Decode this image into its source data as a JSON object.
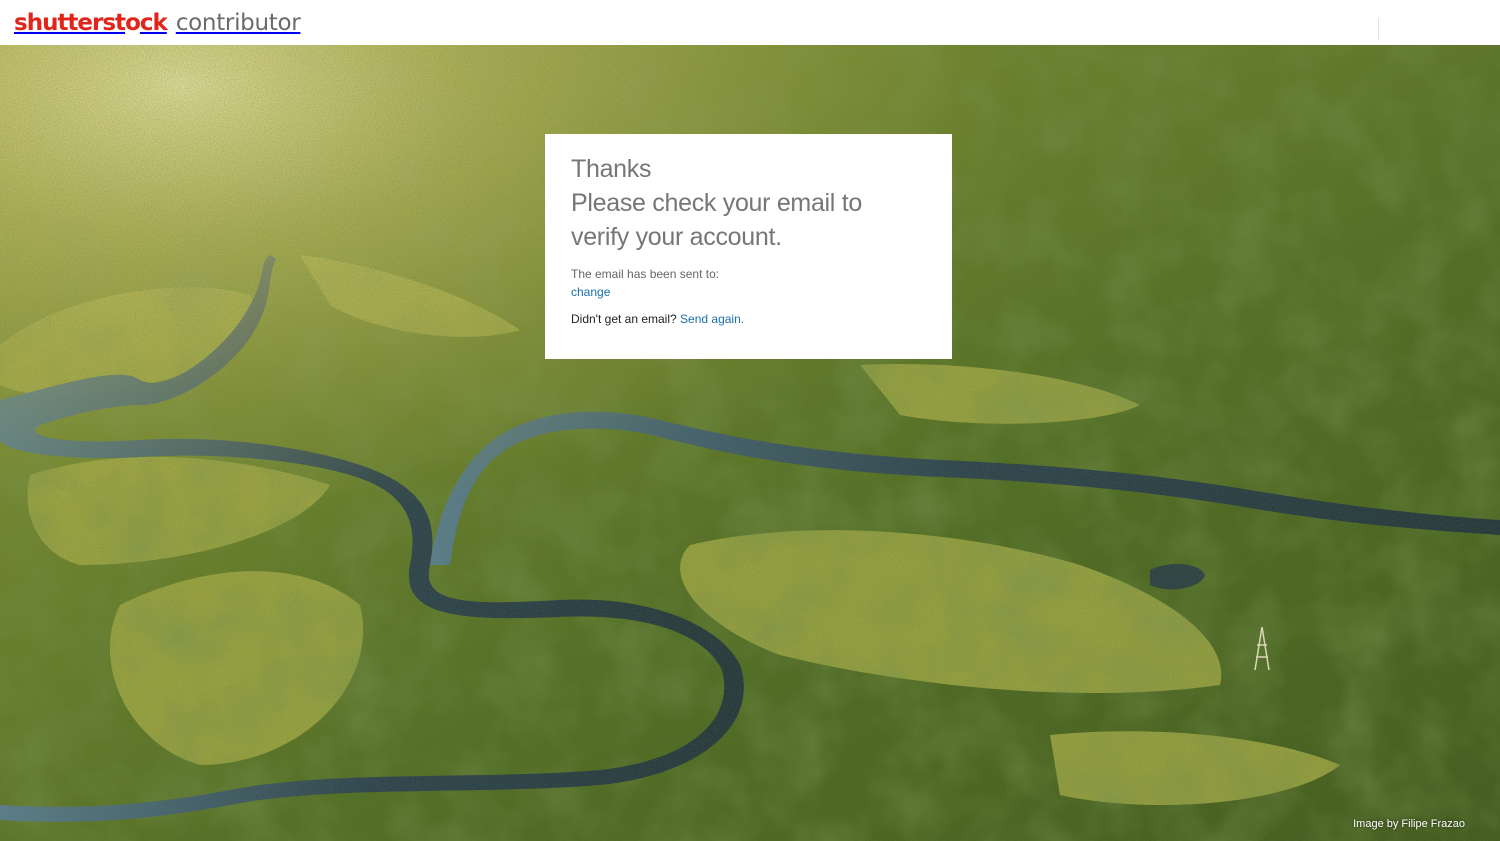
{
  "header": {
    "brand_left": "shutterst",
    "brand_o": "o",
    "brand_right": "ck",
    "product": "contributor",
    "brand_color": "#e1251b",
    "product_color": "#6b6b6b"
  },
  "card": {
    "title_line1": "Thanks",
    "title_line2": "Please check your email to",
    "title_line3": "verify your account.",
    "sent_to_label": "The email has been sent to:",
    "change_link": "change",
    "not_received": "Didn't get an email?",
    "send_again": "Send again.",
    "link_color": "#1a6fb0"
  },
  "background": {
    "credit": "Image by Filipe Frazao",
    "description_icon": "aerial-rainforest-river-photo"
  }
}
